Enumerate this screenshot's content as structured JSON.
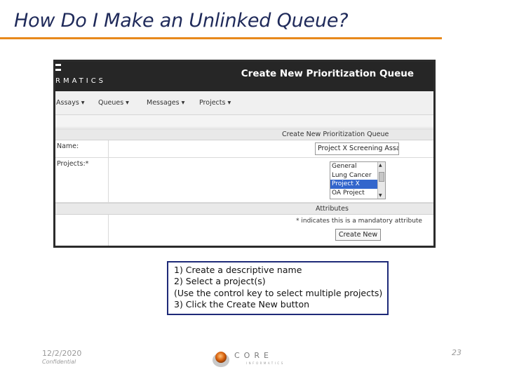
{
  "slide": {
    "title": "How Do I Make an Unlinked Queue?",
    "accent_color": "#e8891c",
    "title_color": "#1f2a5a"
  },
  "app": {
    "brand_text": "RMATICS",
    "header_title": "Create New Prioritization Queue",
    "nav": [
      {
        "label": "Assays ▾"
      },
      {
        "label": "Queues ▾"
      },
      {
        "label": "Messages ▾"
      },
      {
        "label": "Projects ▾"
      }
    ],
    "form": {
      "section_title": "Create New Prioritization Queue",
      "name_label": "Name:",
      "name_value": "Project X Screening Assa",
      "projects_label": "Projects:*",
      "projects_options": [
        {
          "label": "General",
          "selected": false
        },
        {
          "label": "Lung Cancer",
          "selected": false
        },
        {
          "label": "Project X",
          "selected": true
        },
        {
          "label": "OA Project",
          "selected": false
        }
      ],
      "attributes_title": "Attributes",
      "mandatory_note": "* indicates this is a mandatory attribute",
      "create_button": "Create New"
    }
  },
  "instructions": {
    "lines": [
      "1) Create a descriptive name",
      "2) Select a project(s)",
      "(Use the control key to select multiple projects)",
      "3) Click the Create New button"
    ],
    "border_color": "#1e2a78"
  },
  "footer": {
    "date": "12/2/2020",
    "confidential": "Confidential",
    "logo_text": "CORE",
    "logo_subtext": "INFORMATICS",
    "page_number": "23"
  }
}
